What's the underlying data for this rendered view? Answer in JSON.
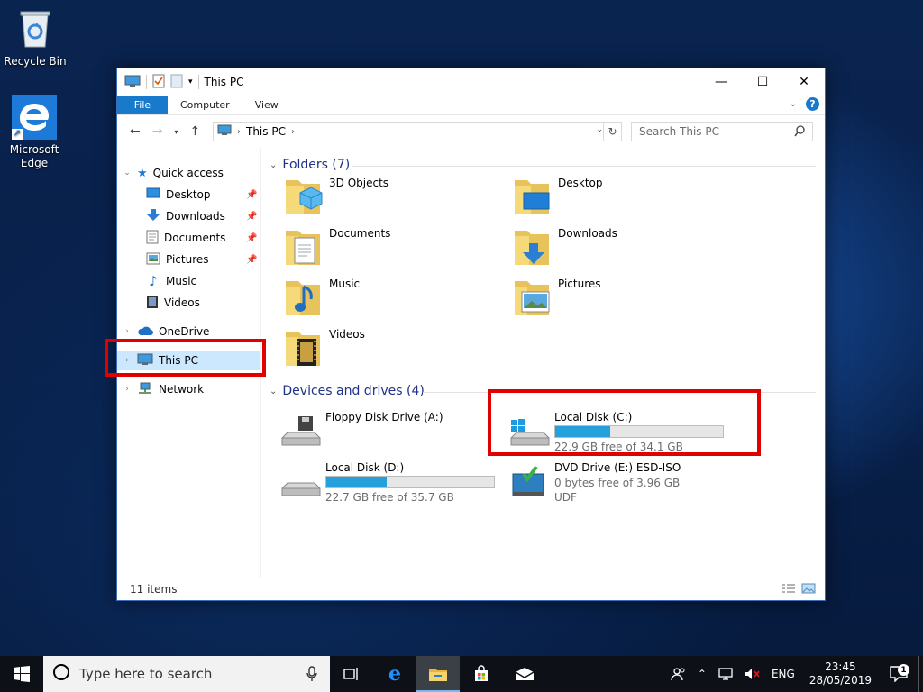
{
  "desktop": {
    "icons": [
      {
        "label": "Recycle Bin",
        "icon": "recycle-bin-icon"
      },
      {
        "label": "Microsoft Edge",
        "icon": "edge-icon"
      }
    ]
  },
  "window": {
    "title": "This PC",
    "ribbon_tabs": [
      "File",
      "Computer",
      "View"
    ],
    "address": {
      "path": [
        "This PC"
      ]
    },
    "search": {
      "placeholder": "Search This PC"
    },
    "controls": {
      "minimize": "—",
      "maximize": "☐",
      "close": "✕"
    },
    "help": "?"
  },
  "nav_pane": {
    "quick_access": "Quick access",
    "quick_items": [
      {
        "label": "Desktop",
        "icon": "desktop-icon",
        "pinned": true
      },
      {
        "label": "Downloads",
        "icon": "downloads-icon",
        "pinned": true
      },
      {
        "label": "Documents",
        "icon": "documents-icon",
        "pinned": true
      },
      {
        "label": "Pictures",
        "icon": "pictures-icon",
        "pinned": true
      },
      {
        "label": "Music",
        "icon": "music-icon",
        "pinned": false
      },
      {
        "label": "Videos",
        "icon": "videos-icon",
        "pinned": false
      }
    ],
    "onedrive": "OneDrive",
    "this_pc": "This PC",
    "network": "Network",
    "selected": "This PC"
  },
  "content": {
    "folders_header": "Folders (7)",
    "folders": [
      {
        "name": "3D Objects",
        "icon": "3d-objects-icon"
      },
      {
        "name": "Desktop",
        "icon": "desktop-folder-icon"
      },
      {
        "name": "Documents",
        "icon": "documents-folder-icon"
      },
      {
        "name": "Downloads",
        "icon": "downloads-folder-icon"
      },
      {
        "name": "Music",
        "icon": "music-folder-icon"
      },
      {
        "name": "Pictures",
        "icon": "pictures-folder-icon"
      },
      {
        "name": "Videos",
        "icon": "videos-folder-icon"
      }
    ],
    "devices_header": "Devices and drives (4)",
    "drives": [
      {
        "name": "Floppy Disk Drive (A:)",
        "icon": "floppy-drive-icon"
      },
      {
        "name": "Local Disk (C:)",
        "icon": "windows-drive-icon",
        "free": "22.9 GB free of 34.1 GB",
        "used_fraction": 0.33
      },
      {
        "name": "Local Disk (D:)",
        "icon": "hard-drive-icon",
        "free": "22.7 GB free of 35.7 GB",
        "used_fraction": 0.36
      },
      {
        "name": "DVD Drive (E:) ESD-ISO",
        "icon": "dvd-drive-icon",
        "info": "0 bytes free of 3.96 GB",
        "fs": "UDF"
      }
    ]
  },
  "status": {
    "items": "11 items"
  },
  "highlight_color": "#e00000",
  "taskbar": {
    "search_placeholder": "Type here to search",
    "apps": [
      "task-view-icon",
      "edge-icon",
      "file-explorer-icon",
      "store-icon",
      "mail-icon"
    ],
    "active_app": "file-explorer-icon",
    "language": "ENG",
    "time": "23:45",
    "date": "28/05/2019",
    "notifications": "1"
  }
}
